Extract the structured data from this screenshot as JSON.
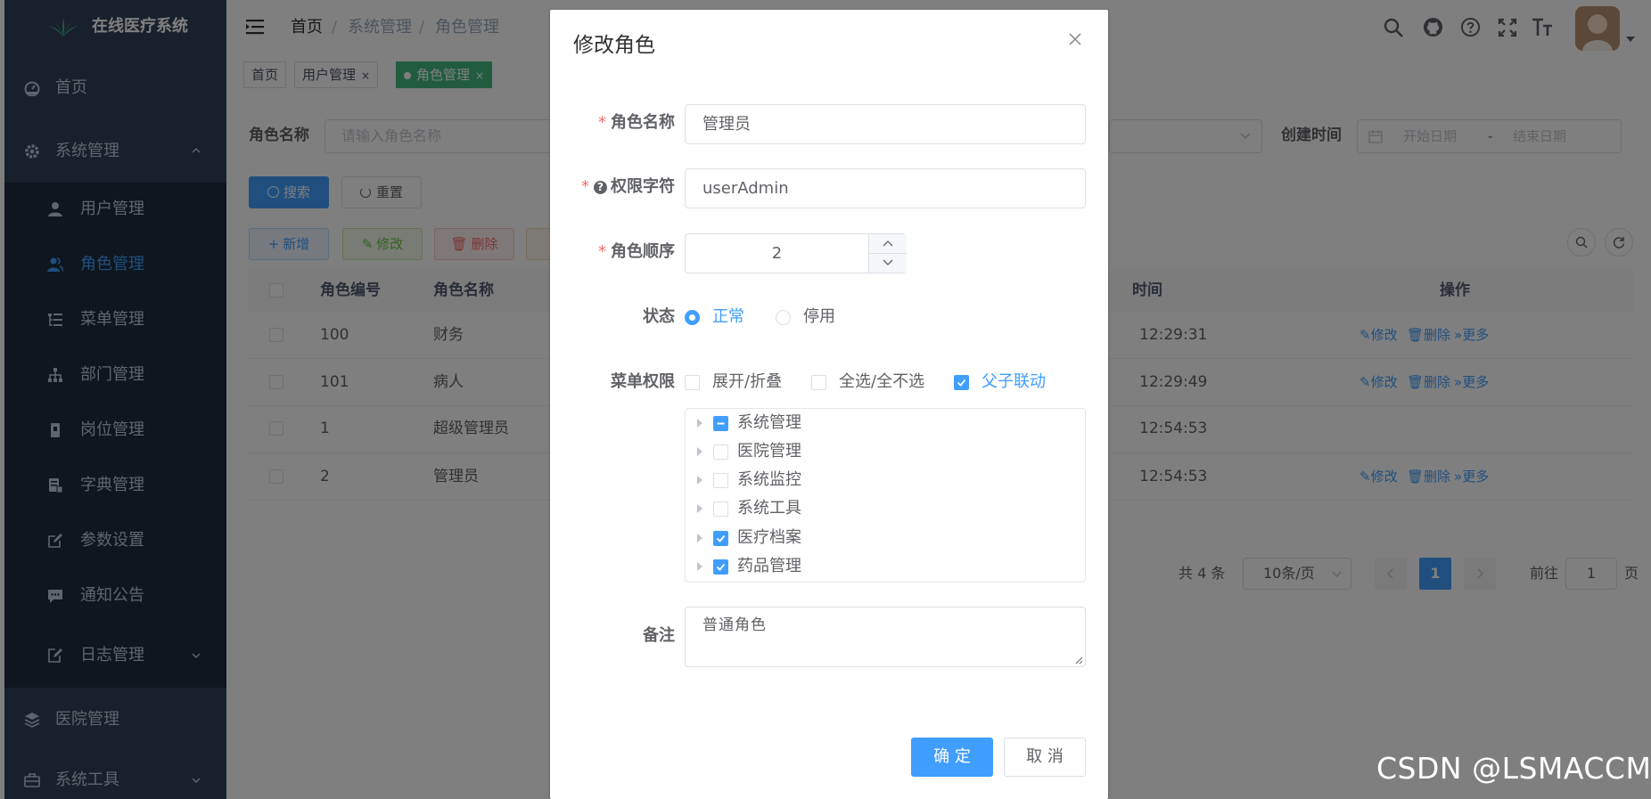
{
  "sidebar": {
    "logo": "在线医疗系统",
    "items": [
      {
        "label": "首页"
      },
      {
        "label": "系统管理"
      },
      {
        "label": "用户管理"
      },
      {
        "label": "角色管理"
      },
      {
        "label": "菜单管理"
      },
      {
        "label": "部门管理"
      },
      {
        "label": "岗位管理"
      },
      {
        "label": "字典管理"
      },
      {
        "label": "参数设置"
      },
      {
        "label": "通知公告"
      },
      {
        "label": "日志管理"
      },
      {
        "label": "医院管理"
      },
      {
        "label": "系统工具"
      }
    ]
  },
  "navbar": {
    "breadcrumb": [
      "首页",
      "/",
      "系统管理",
      "/",
      "角色管理"
    ]
  },
  "tags": [
    {
      "label": "首页"
    },
    {
      "label": "用户管理",
      "close": "×"
    },
    {
      "label": "角色管理",
      "close": "×"
    }
  ],
  "search": {
    "role_name_label": "角色名称",
    "role_name_placeholder": "请输入角色名称",
    "create_time_label": "创建时间",
    "start_placeholder": "开始日期",
    "range_sep": "-",
    "end_placeholder": "结束日期",
    "search_btn": "搜索",
    "reset_btn": "重置"
  },
  "toolbar": {
    "add": "新增",
    "edit": "修改",
    "delete": "删除"
  },
  "table": {
    "headers": [
      "角色编号",
      "角色名称",
      "时间",
      "操作"
    ],
    "rows": [
      {
        "id": "100",
        "name": "财务",
        "time": "12:29:31",
        "ops": [
          "修改",
          "删除",
          "更多"
        ]
      },
      {
        "id": "101",
        "name": "病人",
        "time": "12:29:49",
        "ops": [
          "修改",
          "删除",
          "更多"
        ]
      },
      {
        "id": "1",
        "name": "超级管理员",
        "time": "12:54:53",
        "ops": []
      },
      {
        "id": "2",
        "name": "管理员",
        "time": "12:54:53",
        "ops": [
          "修改",
          "删除",
          "更多"
        ]
      }
    ]
  },
  "pagination": {
    "total": "共 4 条",
    "page_size": "10条/页",
    "current": "1",
    "goto_label": "前往",
    "goto_value": "1",
    "goto_unit": "页"
  },
  "dialog": {
    "title": "修改角色",
    "name_label": "角色名称",
    "name_value": "管理员",
    "key_label": "权限字符",
    "key_value": "userAdmin",
    "sort_label": "角色顺序",
    "sort_value": "2",
    "status_label": "状态",
    "status_options": [
      "正常",
      "停用"
    ],
    "status_selected": "正常",
    "menu_label": "菜单权限",
    "menu_options": [
      {
        "label": "展开/折叠",
        "checked": false
      },
      {
        "label": "全选/全不选",
        "checked": false
      },
      {
        "label": "父子联动",
        "checked": true
      }
    ],
    "tree": [
      {
        "label": "系统管理",
        "state": "indeterminate"
      },
      {
        "label": "医院管理",
        "state": "unchecked"
      },
      {
        "label": "系统监控",
        "state": "unchecked"
      },
      {
        "label": "系统工具",
        "state": "unchecked"
      },
      {
        "label": "医疗档案",
        "state": "checked"
      },
      {
        "label": "药品管理",
        "state": "checked"
      }
    ],
    "remark_label": "备注",
    "remark_value": "普通角色",
    "confirm": "确 定",
    "cancel": "取 消"
  },
  "watermark": "CSDN @LSMACCM",
  "colors": {
    "primary": "#409eff",
    "sidebar_bg": "#304156",
    "required": "#f56c6c"
  }
}
